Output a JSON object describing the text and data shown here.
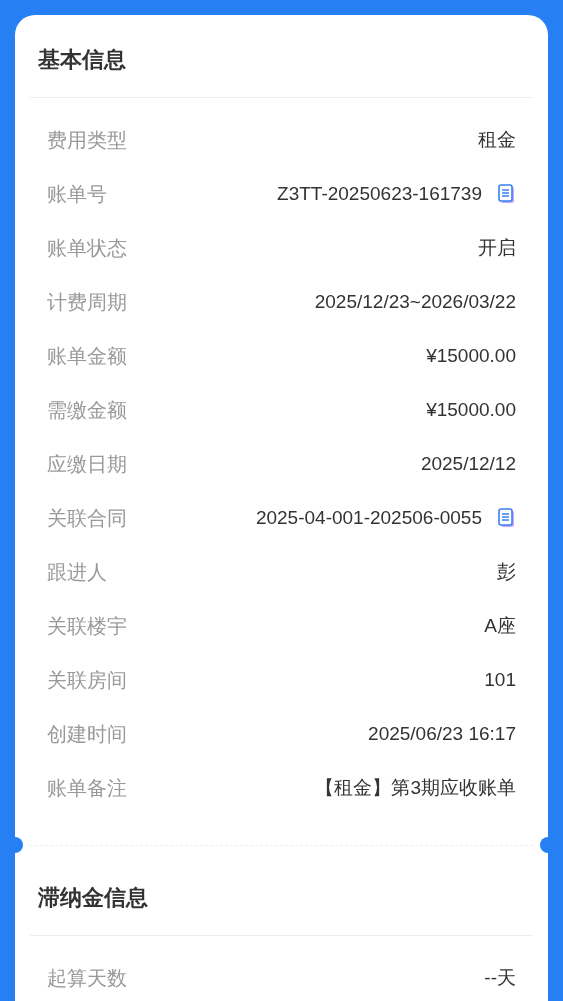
{
  "sections": [
    {
      "title": "基本信息",
      "rows": [
        {
          "label": "费用类型",
          "value": "租金",
          "copyable": false
        },
        {
          "label": "账单号",
          "value": "Z3TT-20250623-161739",
          "copyable": true
        },
        {
          "label": "账单状态",
          "value": "开启",
          "copyable": false
        },
        {
          "label": "计费周期",
          "value": "2025/12/23~2026/03/22",
          "copyable": false
        },
        {
          "label": "账单金额",
          "value": "¥15000.00",
          "copyable": false
        },
        {
          "label": "需缴金额",
          "value": "¥15000.00",
          "copyable": false
        },
        {
          "label": "应缴日期",
          "value": "2025/12/12",
          "copyable": false
        },
        {
          "label": "关联合同",
          "value": "2025-04-001-202506-0055",
          "copyable": true
        },
        {
          "label": "跟进人",
          "value": "彭",
          "copyable": false
        },
        {
          "label": "关联楼宇",
          "value": "A座",
          "copyable": false
        },
        {
          "label": "关联房间",
          "value": "101",
          "copyable": false
        },
        {
          "label": "创建时间",
          "value": "2025/06/23 16:17",
          "copyable": false
        },
        {
          "label": "账单备注",
          "value": "【租金】第3期应收账单",
          "copyable": false
        }
      ]
    },
    {
      "title": "滞纳金信息",
      "rows": [
        {
          "label": "起算天数",
          "value": "--天",
          "copyable": false
        }
      ]
    }
  ]
}
